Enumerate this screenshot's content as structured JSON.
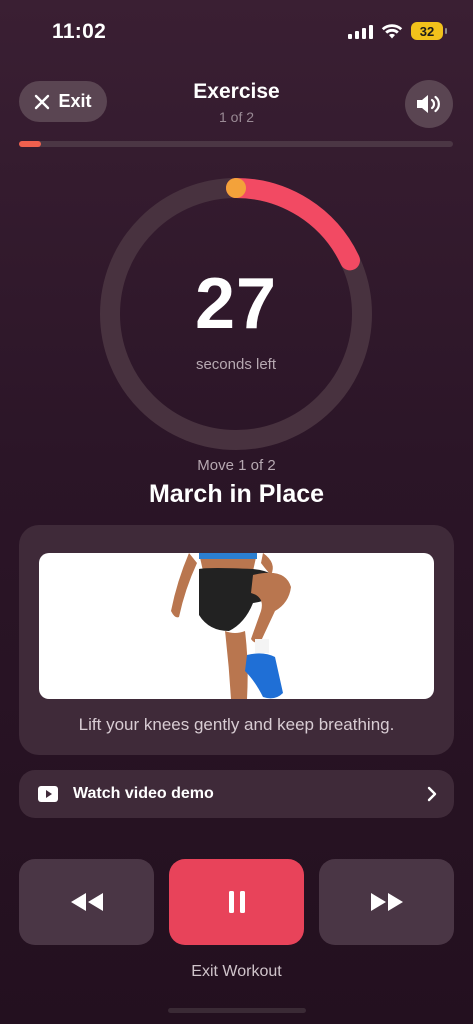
{
  "status_bar": {
    "time": "11:02",
    "battery": "32"
  },
  "header": {
    "exit_label": "Exit",
    "title": "Exercise",
    "subtitle": "1 of 2"
  },
  "progress": {
    "fraction": 0.05
  },
  "timer": {
    "seconds": "27",
    "label": "seconds left",
    "ring_fraction": 0.18,
    "accent": "#f24a63",
    "accent_start": "#f3a23a"
  },
  "move": {
    "counter": "Move 1 of 2",
    "name": "March in Place",
    "instruction": "Lift your knees gently and keep breathing."
  },
  "video": {
    "label": "Watch video demo"
  },
  "controls": {
    "previous_icon": "rewind-icon",
    "pause_icon": "pause-icon",
    "next_icon": "fast-forward-icon",
    "pause_color": "#e8435a"
  },
  "footer": {
    "exit_workout_label": "Exit Workout"
  }
}
